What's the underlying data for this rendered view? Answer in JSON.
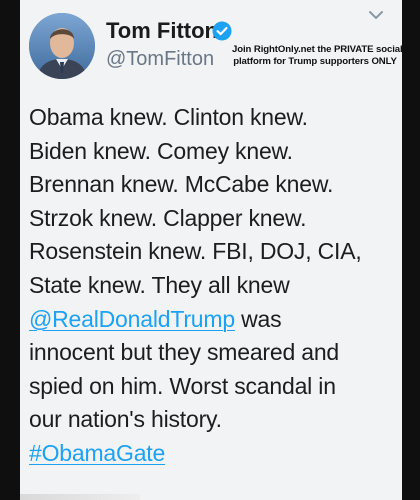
{
  "author": {
    "display_name": "Tom Fitton",
    "handle": "@TomFitton",
    "verified": true,
    "avatar_icon": "profile-photo"
  },
  "promo": {
    "line1": "Join RightOnly.net the PRIVATE social",
    "line2": "platform for Trump supporters ONLY"
  },
  "tweet": {
    "line1": "Obama knew. Clinton knew.",
    "line2": "Biden knew. Comey knew.",
    "line3": "Brennan knew. McCabe knew.",
    "line4": "Strzok knew. Clapper knew.",
    "line5": "Rosenstein knew. FBI, DOJ, CIA,",
    "line6": "State knew. They all knew",
    "mention": "@RealDonaldTrump",
    "line7_rest": " was",
    "line8": "innocent but they smeared and",
    "line9": "spied on him. Worst scandal in",
    "line10": "our nation's history.",
    "hashtag": "#ObamaGate"
  },
  "colors": {
    "card_background": "#f2f3f5",
    "link": "#1da1f2",
    "verified_badge": "#1da1f2",
    "handle": "#6a7785"
  },
  "icons": {
    "verified": "verified-badge-icon",
    "menu": "chevron-down-icon"
  }
}
